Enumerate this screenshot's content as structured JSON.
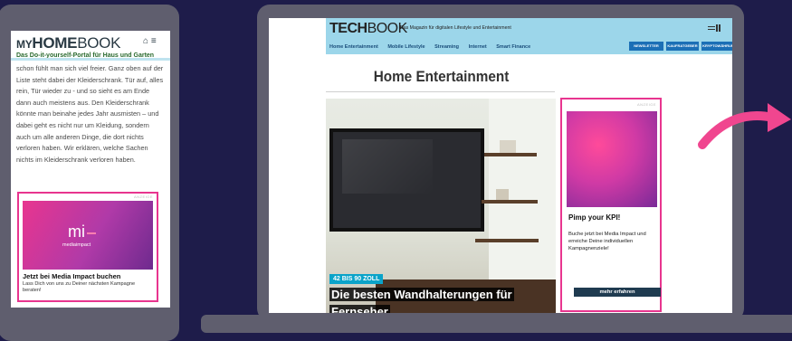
{
  "phone": {
    "logo_my": "MY",
    "logo_home": "HOME",
    "logo_book": "BOOK",
    "header_icons": "⌂ ≡",
    "subtitle": "Das Do-it-yourself-Portal für Haus und Garten",
    "body_text": "schon fühlt man sich viel freier. Ganz oben auf der Liste steht dabei der Kleiderschrank. Tür auf, alles rein, Tür wieder zu - und so sieht es am Ende dann auch meistens aus. Den Kleiderschrank könnte man beinahe jedes Jahr ausmisten – und dabei geht es nicht nur um Kleidung, sondern auch um alle anderen Dinge, die dort nichts verloren haben. Wir erklären, welche Sachen nichts im Kleiderschrank verloren haben.",
    "ad": {
      "label": "ANZEIGE",
      "brand_mi": "mi",
      "brand_text": "mediaimpact",
      "title": "Jetzt bei Media Impact buchen",
      "desc": "Lass Dich von uns zu Deiner nächsten Kampagne beraten!"
    }
  },
  "laptop": {
    "logo_tech": "TECH",
    "logo_book": "BOOK",
    "tagline": "Das Magazin für digitalen Lifestyle und Entertainment",
    "publisher_mark": "AXEL SPRINGER",
    "nav": [
      "Home Entertainment",
      "Mobile Lifestyle",
      "Streaming",
      "Internet",
      "Smart Finance"
    ],
    "buttons": [
      "NEWSLETTER",
      "KAUFRATGEBER",
      "KRYPTOWÄHRUNG"
    ],
    "page_title": "Home Entertainment",
    "hero": {
      "badge": "42 BIS 90 ZOLL",
      "caption": "Die besten Wandhalterungen für Fernseher"
    },
    "ad": {
      "label": "ANZEIGE",
      "title": "Pimp your KPI!",
      "desc": "Buche jetzt bei Media Impact und erreiche Deine individuellen Kampagnenziele!",
      "button": "mehr erfahren"
    }
  },
  "colors": {
    "background": "#1e1c4a",
    "device": "#5f5e6e",
    "accent_pink": "#e8358f",
    "techbook_header": "#9cd6ea",
    "nav_button": "#1b6fb6"
  }
}
